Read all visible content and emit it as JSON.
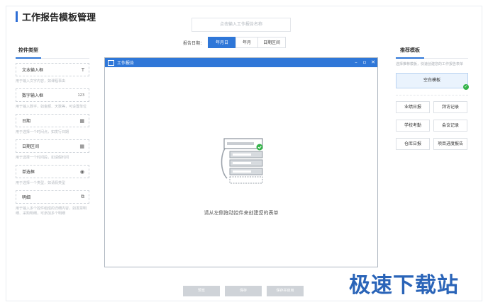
{
  "app": {
    "title": "工作报告模板管理"
  },
  "name_input": {
    "placeholder": "点击输入工作报告名称"
  },
  "date": {
    "label": "报告日期：",
    "options": [
      "年月日",
      "年月",
      "日期区间"
    ],
    "selected": "年月日"
  },
  "left_panel": {
    "title": "控件类型",
    "controls": [
      {
        "label": "文本输入框",
        "icon": "text-icon",
        "glyph": "T",
        "desc": "用于输入文字内容，如课程事由"
      },
      {
        "label": "数字输入框",
        "icon": "number-icon",
        "glyph": "123",
        "desc": "用于输入数字，如金额、天数等，可设置单位"
      },
      {
        "label": "日期",
        "icon": "calendar-icon",
        "glyph": "▦",
        "desc": "用于选择一个时间点，如发行日期"
      },
      {
        "label": "日期区间",
        "icon": "calendar-range-icon",
        "glyph": "▦",
        "desc": "用于选择一个时间段，如请假时间"
      },
      {
        "label": "单选框",
        "icon": "radio-icon",
        "glyph": "◉",
        "desc": "用于选择一个类型，如请假类型"
      },
      {
        "label": "明细",
        "icon": "detail-icon",
        "glyph": "⧉",
        "desc": "用于输入多个控件组成的详细内容，如发票明细、采购明细，可添加多个明细"
      }
    ]
  },
  "dialog": {
    "title": "工作报告",
    "empty_text": "请从左侧拖动控件来创建您的表单"
  },
  "right_panel": {
    "title": "推荐模板",
    "desc": "选择推荐模板，快速创建您的工作报告表单",
    "blank_template": "空白模板",
    "templates": [
      "业绩日报",
      "拜访记录",
      "学校考勤",
      "会议记录",
      "仓库日报",
      "项目进度报告"
    ]
  },
  "bottom": {
    "buttons": [
      "预览",
      "保存",
      "保存并启用"
    ]
  },
  "watermark": "极速下载站",
  "colors": {
    "accent": "#2f77d8",
    "success": "#34b34a"
  }
}
